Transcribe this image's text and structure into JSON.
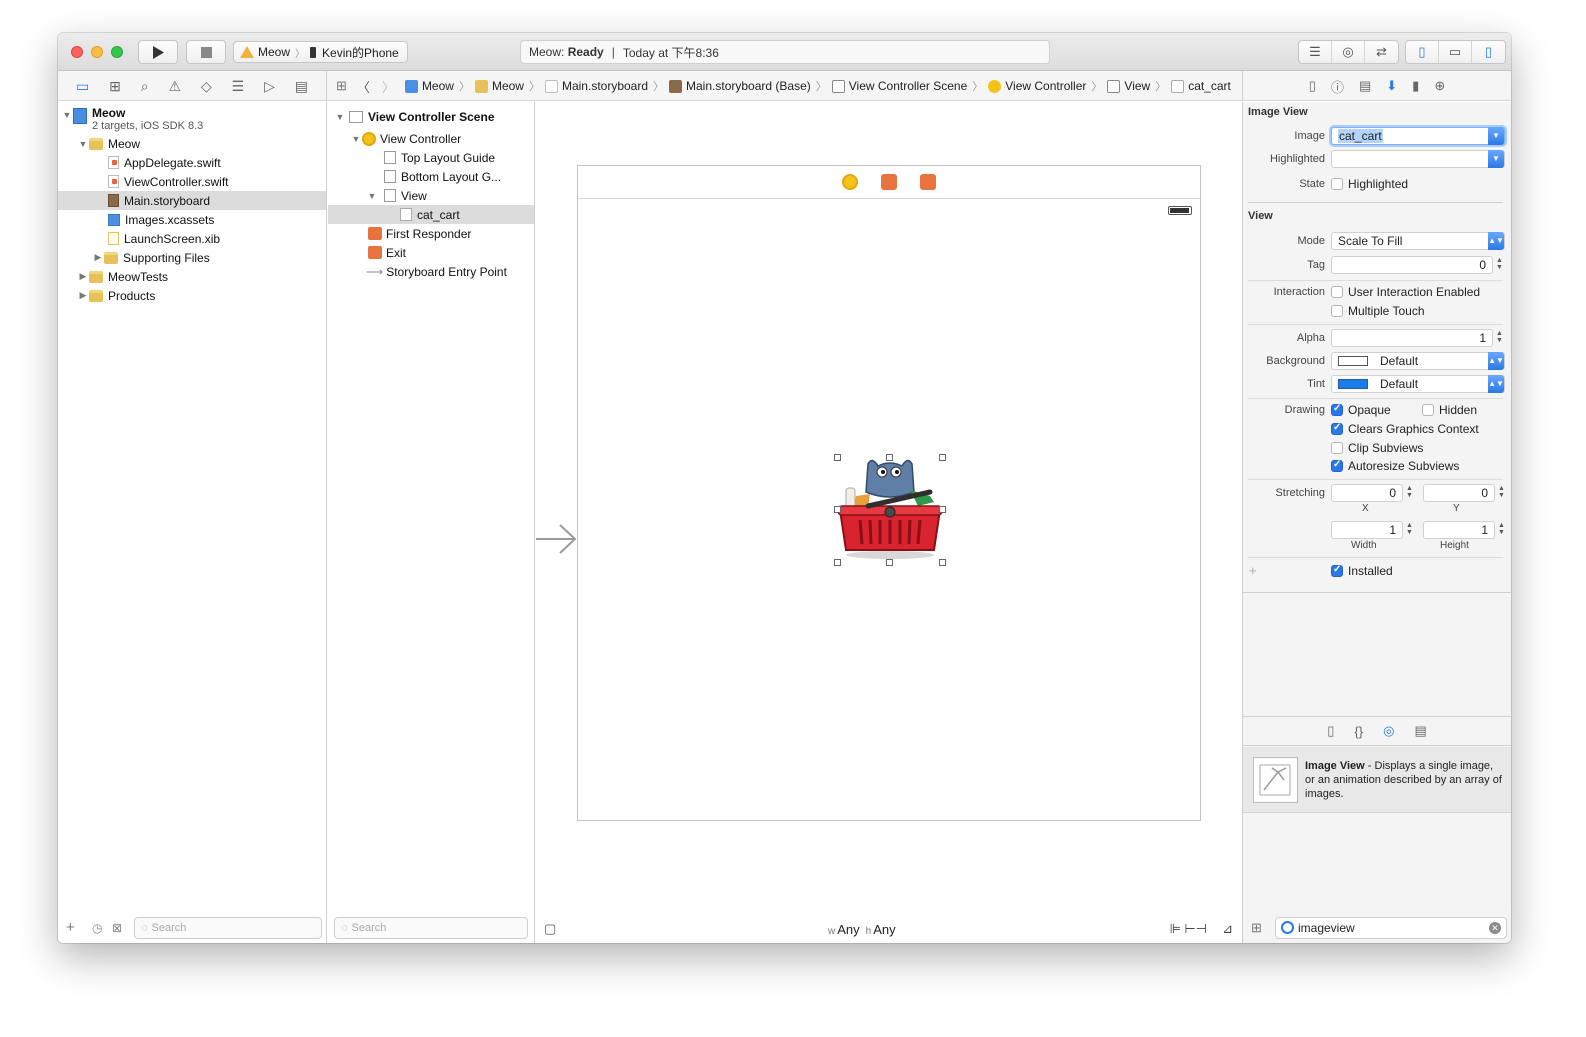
{
  "toolbar": {
    "scheme_project": "Meow",
    "scheme_device": "Kevin的Phone",
    "status_app": "Meow:",
    "status_state": "Ready",
    "status_time": "Today at 下午8:36"
  },
  "jumpbar": {
    "crumbs": [
      "Meow",
      "Meow",
      "Main.storyboard",
      "Main.storyboard (Base)",
      "View Controller Scene",
      "View Controller",
      "View",
      "cat_cart"
    ]
  },
  "navigator": {
    "project_name": "Meow",
    "project_subtitle": "2 targets, iOS SDK 8.3",
    "group_meow": "Meow",
    "files": [
      "AppDelegate.swift",
      "ViewController.swift",
      "Main.storyboard",
      "Images.xcassets",
      "LaunchScreen.xib"
    ],
    "supporting": "Supporting Files",
    "tests": "MeowTests",
    "products": "Products",
    "search_placeholder": "Search"
  },
  "outline": {
    "scene": "View Controller Scene",
    "vc": "View Controller",
    "top_guide": "Top Layout Guide",
    "bottom_guide": "Bottom Layout G...",
    "view": "View",
    "image": "cat_cart",
    "first_responder": "First Responder",
    "exit": "Exit",
    "entry": "Storyboard Entry Point",
    "search_placeholder": "Search"
  },
  "canvas": {
    "size_w_prefix": "w",
    "size_w": "Any",
    "size_h_prefix": "h",
    "size_h": "Any"
  },
  "inspector": {
    "image_view_title": "Image View",
    "image_label": "Image",
    "image_value": "cat_cart",
    "highlighted_label": "Highlighted",
    "highlighted_value": "",
    "state_label": "State",
    "state_checkbox": "Highlighted",
    "view_title": "View",
    "mode_label": "Mode",
    "mode_value": "Scale To Fill",
    "tag_label": "Tag",
    "tag_value": "0",
    "interaction_label": "Interaction",
    "user_interaction": "User Interaction Enabled",
    "multiple_touch": "Multiple Touch",
    "alpha_label": "Alpha",
    "alpha_value": "1",
    "background_label": "Background",
    "background_value": "Default",
    "tint_label": "Tint",
    "tint_value": "Default",
    "drawing_label": "Drawing",
    "opaque": "Opaque",
    "hidden": "Hidden",
    "clears": "Clears Graphics Context",
    "clip": "Clip Subviews",
    "autoresize": "Autoresize Subviews",
    "stretching_label": "Stretching",
    "stretch_x": "0",
    "stretch_y": "0",
    "stretch_w": "1",
    "stretch_h": "1",
    "x_label": "X",
    "y_label": "Y",
    "width_label": "Width",
    "height_label": "Height",
    "installed": "Installed",
    "plus": "+"
  },
  "library": {
    "item_title": "Image View",
    "item_desc": " - Displays a single image, or an animation described by an array of images.",
    "filter_value": "imageview"
  },
  "colors": {
    "accent": "#2a78e4",
    "tint_swatch": "#1e7be6"
  }
}
